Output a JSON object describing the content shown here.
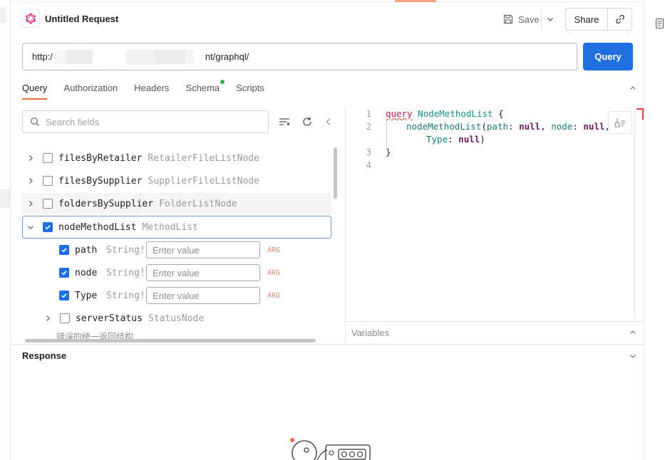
{
  "request": {
    "title": "Untitled Request",
    "save_label": "Save",
    "share_label": "Share",
    "url_prefix": "http:/",
    "url_suffix": "nt/graphql/",
    "query_button": "Query"
  },
  "tabs": [
    {
      "label": "Query",
      "active": true
    },
    {
      "label": "Authorization",
      "active": false
    },
    {
      "label": "Headers",
      "active": false
    },
    {
      "label": "Schema",
      "active": false,
      "dot_color": "#27b35b"
    },
    {
      "label": "Scripts",
      "active": false
    }
  ],
  "schema": {
    "search_placeholder": "Search fields",
    "fields": [
      {
        "name": "filesByRetailer",
        "type": "RetailerFileListNode",
        "checked": false,
        "expanded": false
      },
      {
        "name": "filesBySupplier",
        "type": "SupplierFileListNode",
        "checked": false,
        "expanded": false
      },
      {
        "name": "foldersBySupplier",
        "type": "FolderListNode",
        "checked": false,
        "expanded": false
      },
      {
        "name": "nodeMethodList",
        "type": "MethodList",
        "checked": true,
        "expanded": true
      }
    ],
    "args": [
      {
        "name": "path",
        "type": "String!",
        "placeholder": "Enter value",
        "tag": "ARG",
        "checked": true
      },
      {
        "name": "node",
        "type": "String!",
        "placeholder": "Enter value",
        "tag": "ARG",
        "checked": true
      },
      {
        "name": "Type",
        "type": "String!",
        "placeholder": "Enter value",
        "tag": "ARG",
        "checked": true
      }
    ],
    "subfield": {
      "name": "serverStatus",
      "type": "StatusNode",
      "checked": false
    },
    "truncated_text": "错误的统一返回结构"
  },
  "editor": {
    "line_numbers": [
      "1",
      "2",
      "3",
      "4"
    ],
    "code": {
      "kw_query": "query",
      "op_name": "NodeMethodList",
      "open_brace": " {",
      "field": "nodeMethodList",
      "arg_path": "path",
      "arg_node": "node",
      "arg_type": "Type",
      "null_value": "null",
      "close_brace": "}"
    }
  },
  "variables_label": "Variables",
  "response_label": "Response",
  "colors": {
    "accent": "#f26b3a",
    "primary": "#1f6fe0",
    "schema_dot": "#27b35b"
  }
}
